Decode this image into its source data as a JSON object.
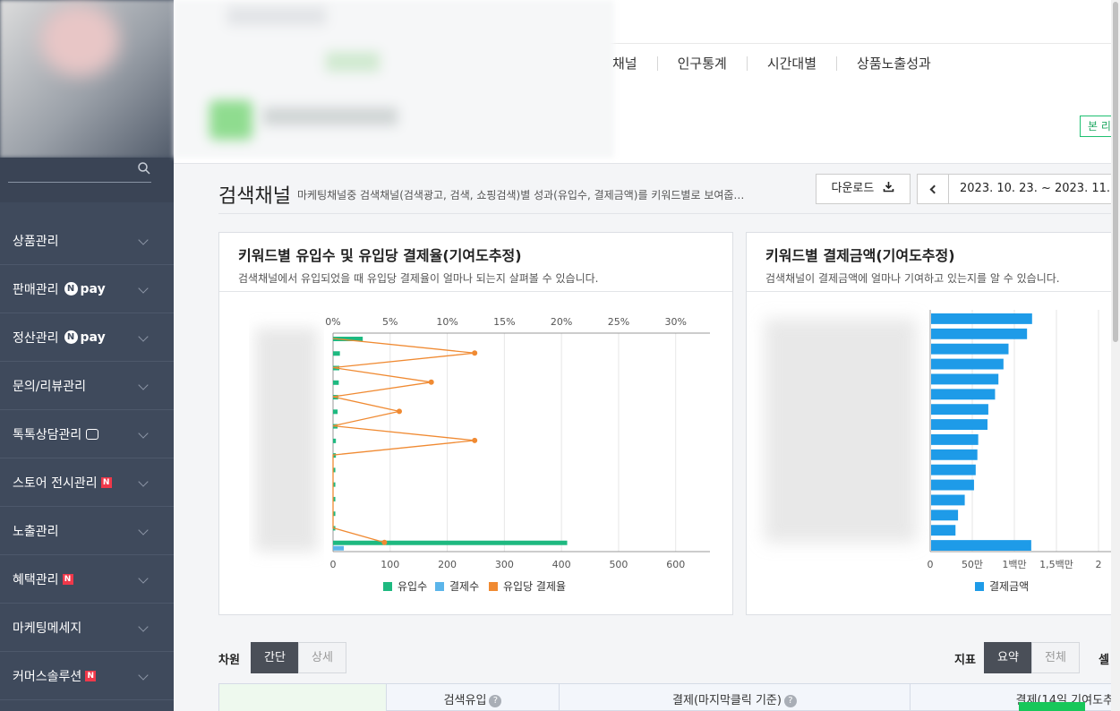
{
  "sidebar": {
    "search_placeholder": "",
    "menu": [
      {
        "label": "상품관리",
        "badge": ""
      },
      {
        "label": "판매관리",
        "badge": "npay"
      },
      {
        "label": "정산관리",
        "badge": "npay"
      },
      {
        "label": "문의/리뷰관리",
        "badge": ""
      },
      {
        "label": "톡톡상담관리",
        "badge": "chat"
      },
      {
        "label": "스토어 전시관리",
        "badge": "N"
      },
      {
        "label": "노출관리",
        "badge": ""
      },
      {
        "label": "혜택관리",
        "badge": "N"
      },
      {
        "label": "마케팅메세지",
        "badge": ""
      },
      {
        "label": "커머스솔루션",
        "badge": "N"
      }
    ],
    "npay_text": "pay",
    "npay_n": "N",
    "badge_n": "N"
  },
  "header": {
    "tabs": [
      "채널",
      "인구통계",
      "시간대별",
      "상품노출성과"
    ],
    "report_button": "본 리"
  },
  "title_row": {
    "title": "검색채널",
    "description": "마케팅채널중 검색채널(검색광고, 검색, 쇼핑검색)별 성과(유입수, 결제금액)를 키워드별로 보여줍…",
    "download_label": "다운로드",
    "date_range": "2023. 10. 23. ~ 2023. 11."
  },
  "panel_left": {
    "title": "키워드별 유입수 및 유입당 결제율(기여도추정)",
    "subtitle": "검색채널에서 유입되었을 때 유입당 결제율이 얼마나 되는지 살펴볼 수 있습니다."
  },
  "panel_right": {
    "title": "키워드별 결제금액(기여도추정)",
    "subtitle": "검색채널이 결제금액에 얼마나 기여하고 있는지를 알 수 있습니다."
  },
  "chart_data": [
    {
      "type": "bar",
      "orientation": "horizontal",
      "categories": [
        "",
        "",
        "",
        "",
        "",
        "",
        "",
        "",
        "",
        "",
        "",
        "",
        "",
        "",
        ""
      ],
      "x_bottom_ticks": [
        "0",
        "100",
        "200",
        "300",
        "400",
        "500",
        "600"
      ],
      "x_bottom_range": [
        0,
        600
      ],
      "x_top_ticks": [
        "0%",
        "5%",
        "10%",
        "15%",
        "20%",
        "25%",
        "30%"
      ],
      "x_top_range": [
        0,
        30
      ],
      "grid": true,
      "legend_position": "bottom",
      "series": [
        {
          "name": "유입수",
          "color": "#1eb980",
          "values": [
            52,
            12,
            11,
            10,
            9,
            8,
            8,
            5,
            5,
            4,
            4,
            4,
            4,
            4,
            410
          ]
        },
        {
          "name": "결제수",
          "color": "#5bb5ea",
          "values": [
            0,
            0,
            0,
            0,
            0,
            0,
            0,
            0,
            0,
            0,
            0,
            0,
            0,
            0,
            10
          ]
        },
        {
          "name": "유입당 결제율",
          "color": "#f08a32",
          "axis": "top",
          "values": [
            0,
            12.4,
            0,
            8.6,
            0,
            5.8,
            0,
            12.4,
            0,
            0,
            0,
            0,
            0,
            0,
            4.5
          ]
        }
      ]
    },
    {
      "type": "bar",
      "orientation": "horizontal",
      "categories": [
        "",
        "",
        "",
        "",
        "",
        "",
        "",
        "",
        "",
        "",
        "",
        "",
        "",
        "",
        ""
      ],
      "x_ticks": [
        "0",
        "50만",
        "1백만",
        "1,5백만",
        "2"
      ],
      "x_range": [
        0,
        2000000
      ],
      "grid": true,
      "legend_position": "bottom",
      "series": [
        {
          "name": "결제금액",
          "color": "#1e9be8",
          "values": [
            1200000,
            1140000,
            920000,
            860000,
            800000,
            760000,
            680000,
            670000,
            560000,
            550000,
            530000,
            510000,
            400000,
            320000,
            290000,
            1190000
          ]
        }
      ]
    }
  ],
  "dimension": {
    "label": "차원",
    "options": [
      "간단",
      "상세"
    ],
    "selected": "간단",
    "metric_label": "지표",
    "metric_options": [
      "요약",
      "전체"
    ],
    "metric_selected": "요약",
    "sel_label": "셀"
  },
  "table": {
    "headers": [
      "",
      "검색유입",
      "결제(마지막클릭 기준)",
      "결제(14일 기여도추"
    ]
  },
  "colors": {
    "sidebar_bg": "#3f4a5c",
    "accent_green": "#1eb980",
    "accent_orange": "#f08a32",
    "accent_blue": "#1e9be8"
  }
}
